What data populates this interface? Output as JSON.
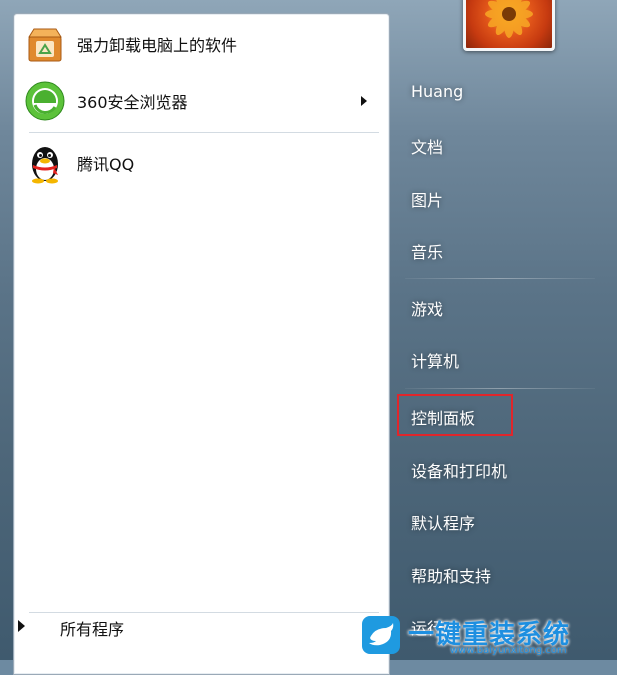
{
  "pinned_programs": [
    {
      "label": "强力卸载电脑上的软件",
      "icon": "uninstaller-box-icon"
    },
    {
      "label": "360安全浏览器",
      "icon": "360-browser-icon",
      "has_submenu": true
    },
    {
      "label": "腾讯QQ",
      "icon": "qq-penguin-icon"
    }
  ],
  "all_programs_label": "所有程序",
  "right_pane": {
    "user_name": "Huang",
    "documents": "文档",
    "pictures": "图片",
    "music": "音乐",
    "games": "游戏",
    "computer": "计算机",
    "control_panel": "控制面板",
    "devices_printers": "设备和打印机",
    "default_programs": "默认程序",
    "help_support": "帮助和支持",
    "run": "运行..."
  },
  "watermark": {
    "text": "一键重装系统",
    "url": "www.baiyunxitong.com"
  },
  "colors": {
    "highlight": "#e0262b",
    "watermark": "#1e8fe0"
  }
}
